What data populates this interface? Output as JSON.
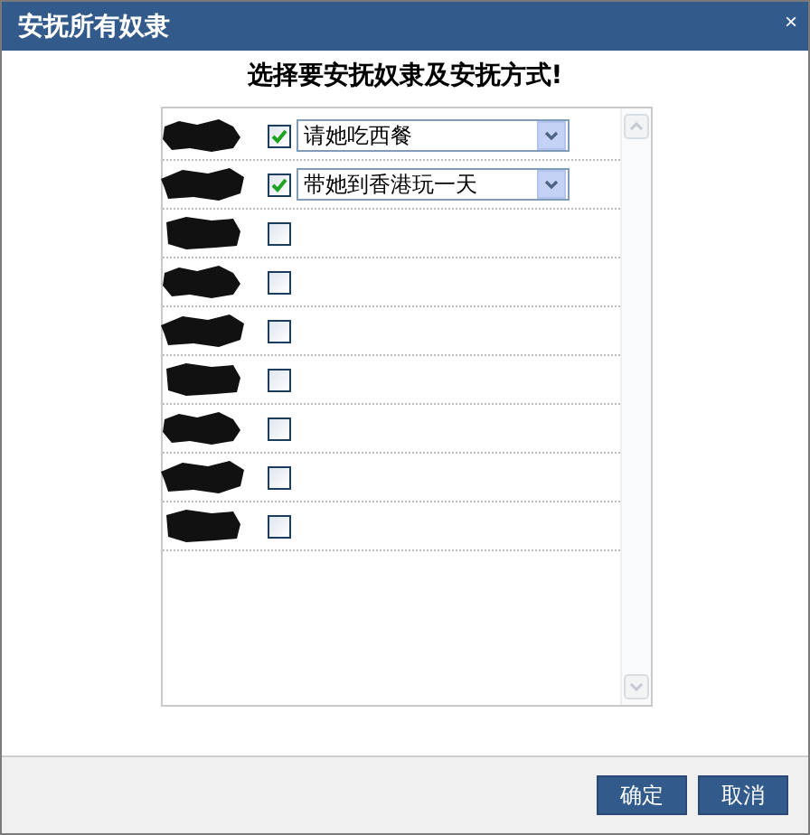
{
  "window": {
    "title": "安抚所有奴隶",
    "close": "×"
  },
  "heading": "选择要安抚奴隶及安抚方式!",
  "rows": [
    {
      "checked": true,
      "method": "请她吃西餐"
    },
    {
      "checked": true,
      "method": "带她到香港玩一天"
    },
    {
      "checked": false
    },
    {
      "checked": false
    },
    {
      "checked": false
    },
    {
      "checked": false
    },
    {
      "checked": false
    },
    {
      "checked": false
    },
    {
      "checked": false
    }
  ],
  "buttons": [
    "确定",
    "取消"
  ]
}
